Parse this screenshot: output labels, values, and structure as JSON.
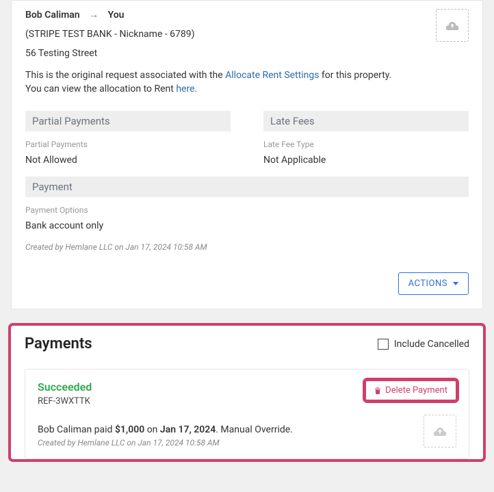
{
  "request": {
    "from": "Bob Caliman",
    "to": "You",
    "bank": "(STRIPE TEST BANK - Nickname - 6789)",
    "address": "56 Testing Street",
    "note_pre": "This is the original request associated with the ",
    "note_link": "Allocate Rent Settings",
    "note_post": " for this property.",
    "note2_pre": "You can view the allocation to Rent ",
    "note2_link": "here",
    "note2_post": "."
  },
  "partial": {
    "heading": "Partial Payments",
    "label": "Partial Payments",
    "value": "Not Allowed"
  },
  "late": {
    "heading": "Late Fees",
    "label": "Late Fee Type",
    "value": "Not Applicable"
  },
  "paymentOpts": {
    "heading": "Payment",
    "label": "Payment Options",
    "value": "Bank account only"
  },
  "created": "Created by Hemlane LLC on Jan 17, 2024 10:58 AM",
  "actionsLabel": "ACTIONS",
  "payments": {
    "title": "Payments",
    "includeCancelled": "Include Cancelled",
    "item": {
      "status": "Succeeded",
      "ref": "REF-3WXTTK",
      "desc_pre": "Bob Caliman paid ",
      "desc_amount": "$1,000",
      "desc_mid": " on ",
      "desc_date": "Jan 17, 2024",
      "desc_post": ". Manual Override.",
      "created": "Created by Hemlane LLC on Jan 17, 2024 10:58 AM",
      "deleteLabel": "Delete Payment"
    }
  }
}
